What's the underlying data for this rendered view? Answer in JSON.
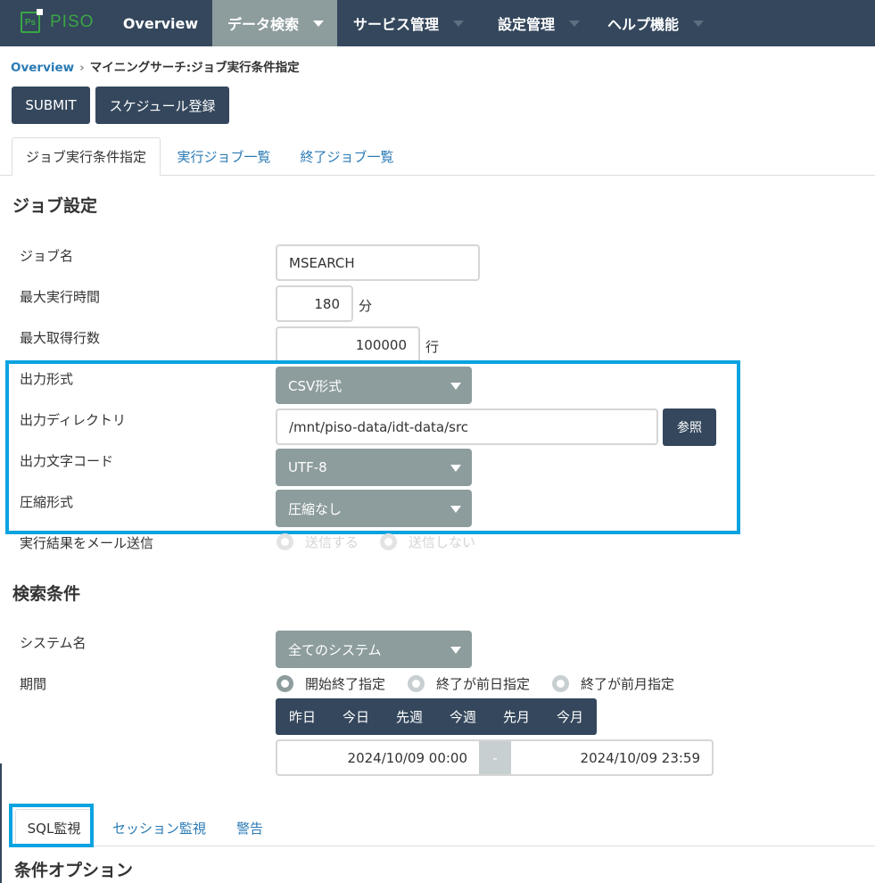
{
  "logo": {
    "badge": "Ps",
    "name": "PISO"
  },
  "nav": {
    "items": [
      {
        "label": "Overview",
        "dropdown": false
      },
      {
        "label": "データ検索",
        "dropdown": true
      },
      {
        "label": "サービス管理",
        "dropdown": true
      },
      {
        "label": "設定管理",
        "dropdown": true
      },
      {
        "label": "ヘルプ機能",
        "dropdown": true
      }
    ],
    "active_index": 1
  },
  "breadcrumb": {
    "home": "Overview",
    "separator": "›",
    "current": "マイニングサーチ:ジョブ実行条件指定"
  },
  "actions": {
    "submit_label": "SUBMIT",
    "schedule_label": "スケジュール登録"
  },
  "job_tabs": [
    "ジョブ実行条件指定",
    "実行ジョブ一覧",
    "終了ジョブ一覧"
  ],
  "job_settings": {
    "title": "ジョブ設定",
    "job_name": {
      "label": "ジョブ名",
      "value": "MSEARCH"
    },
    "max_time": {
      "label": "最大実行時間",
      "value": "180",
      "unit": "分"
    },
    "max_rows": {
      "label": "最大取得行数",
      "value": "100000",
      "unit": "行"
    },
    "output_format": {
      "label": "出力形式",
      "value": "CSV形式"
    },
    "output_dir": {
      "label": "出力ディレクトリ",
      "value": "/mnt/piso-data/idt-data/src",
      "browse_label": "参照"
    },
    "output_encoding": {
      "label": "出力文字コード",
      "value": "UTF-8"
    },
    "compression": {
      "label": "圧縮形式",
      "value": "圧縮なし"
    },
    "mail": {
      "label": "実行結果をメール送信",
      "options": [
        "送信する",
        "送信しない"
      ],
      "selected": 1,
      "disabled": true
    }
  },
  "search_conditions": {
    "title": "検索条件",
    "system": {
      "label": "システム名",
      "value": "全てのシステム"
    },
    "period": {
      "label": "期間",
      "modes": [
        "開始終了指定",
        "終了が前日指定",
        "終了が前月指定"
      ],
      "selected": 0,
      "quick_buttons": [
        "昨日",
        "今日",
        "先週",
        "今週",
        "先月",
        "今月"
      ],
      "start": "2024/10/09 00:00",
      "separator": "-",
      "end": "2024/10/09 23:59"
    }
  },
  "monitor_tabs": [
    "SQL監視",
    "セッション監視",
    "警告"
  ],
  "condition_options": {
    "title": "条件オプション"
  },
  "colors": {
    "nav_bg": "#34475c",
    "active_nav": "#8d9c9d",
    "link": "#2a7ab5",
    "highlight": "#0aa3e0",
    "logo_green": "#3aa545"
  }
}
